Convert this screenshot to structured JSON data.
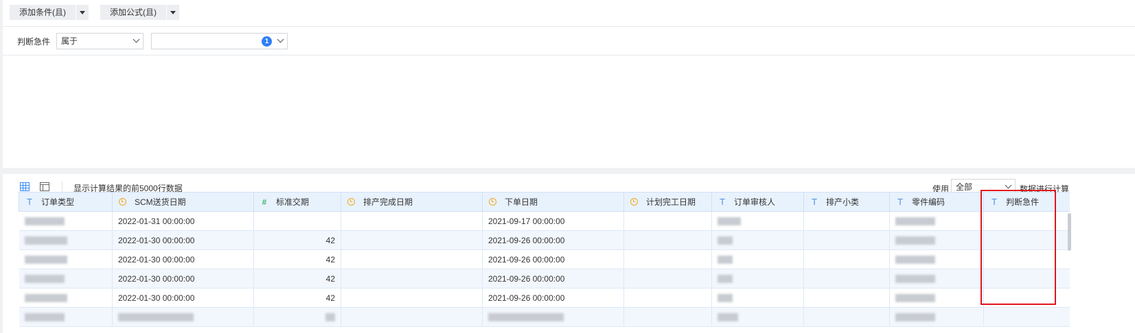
{
  "toolbar_top": {
    "add_condition": "添加条件(且)",
    "add_formula": "添加公式(且)"
  },
  "condition": {
    "field_label": "判断急件",
    "operator": "属于",
    "value": "",
    "selected_count": "1"
  },
  "result_bar": {
    "info": "显示计算结果的前5000行数据",
    "use_label": "使用",
    "use_value": "全部",
    "after_label": "数据进行计算"
  },
  "icons": {
    "grid_view": "grid-icon",
    "table_view": "table-layout-icon",
    "text_type": "T",
    "number_type": "#",
    "date_type": "clock-icon"
  },
  "columns": [
    {
      "label": "订单类型",
      "type": "text"
    },
    {
      "label": "SCM送货日期",
      "type": "date"
    },
    {
      "label": "标准交期",
      "type": "number"
    },
    {
      "label": "排产完成日期",
      "type": "date"
    },
    {
      "label": "下单日期",
      "type": "date"
    },
    {
      "label": "计划完工日期",
      "type": "date"
    },
    {
      "label": "订单审核人",
      "type": "text"
    },
    {
      "label": "排产小类",
      "type": "text"
    },
    {
      "label": "零件编码",
      "type": "text"
    },
    {
      "label": "判断急件",
      "type": "text"
    }
  ],
  "rows": [
    {
      "scm": "2022-01-31 00:00:00",
      "std": "",
      "order_date": "2021-09-17 00:00:00"
    },
    {
      "scm": "2022-01-30 00:00:00",
      "std": "42",
      "order_date": "2021-09-26 00:00:00"
    },
    {
      "scm": "2022-01-30 00:00:00",
      "std": "42",
      "order_date": "2021-09-26 00:00:00"
    },
    {
      "scm": "2022-01-30 00:00:00",
      "std": "42",
      "order_date": "2021-09-26 00:00:00"
    },
    {
      "scm": "2022-01-30 00:00:00",
      "std": "42",
      "order_date": "2021-09-26 00:00:00"
    }
  ],
  "colors": {
    "accent": "#2e7ef5",
    "header_bg": "#e8f2fd",
    "highlight_border": "#e0161d",
    "date_icon": "#f5a623",
    "number_icon": "#3cb371"
  }
}
